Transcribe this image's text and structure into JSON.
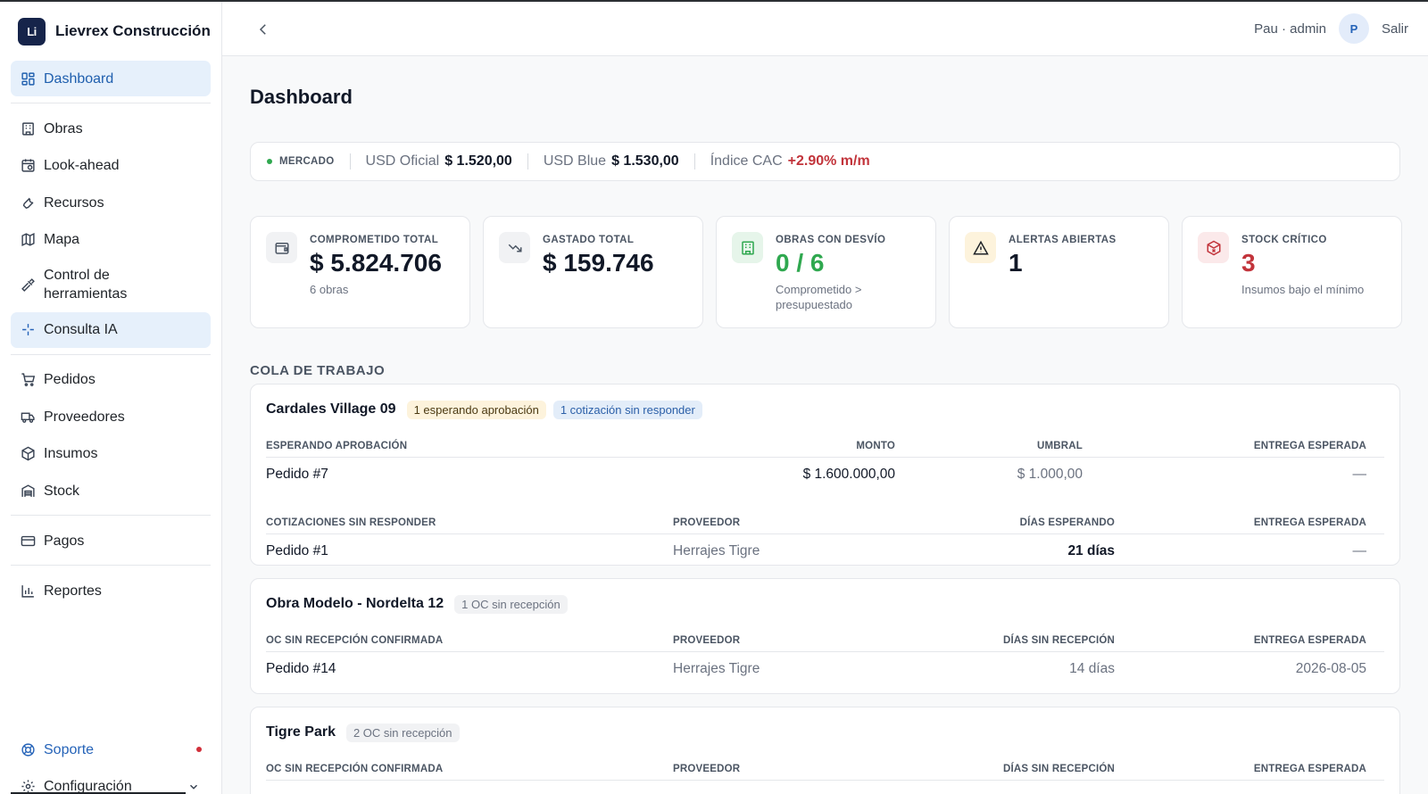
{
  "app": {
    "brand_name": "Lievrex Construcción",
    "logo_text": "Li"
  },
  "sidebar": {
    "items": [
      {
        "label": "Dashboard",
        "icon": "dashboard-icon"
      },
      {
        "label": "Obras",
        "icon": "building-icon"
      },
      {
        "label": "Look-ahead",
        "icon": "calendar-clock-icon"
      },
      {
        "label": "Recursos",
        "icon": "wrench-icon"
      },
      {
        "label": "Mapa",
        "icon": "map-icon"
      },
      {
        "label": "Control de herramientas",
        "icon": "hammer-icon"
      },
      {
        "label": "Consulta IA",
        "icon": "sparkle-icon"
      },
      {
        "label": "Pedidos",
        "icon": "cart-icon"
      },
      {
        "label": "Proveedores",
        "icon": "truck-icon"
      },
      {
        "label": "Insumos",
        "icon": "box-icon"
      },
      {
        "label": "Stock",
        "icon": "warehouse-icon"
      },
      {
        "label": "Pagos",
        "icon": "credit-card-icon"
      },
      {
        "label": "Reportes",
        "icon": "bar-chart-icon"
      }
    ],
    "support_label": "Soporte",
    "settings_label": "Configuración"
  },
  "topbar": {
    "user_label": "Pau · admin",
    "avatar_initial": "P",
    "logout_label": "Salir"
  },
  "page": {
    "title": "Dashboard"
  },
  "market": {
    "tag": "MERCADO",
    "usd_oficial_label": "USD Oficial",
    "usd_oficial_value": "$ 1.520,00",
    "usd_blue_label": "USD Blue",
    "usd_blue_value": "$ 1.530,00",
    "cac_label": "Índice CAC",
    "cac_value": "+2.90% m/m"
  },
  "kpis": [
    {
      "label": "COMPROMETIDO TOTAL",
      "value": "$ 5.824.706",
      "sub": "6 obras",
      "icon": "wallet-icon"
    },
    {
      "label": "GASTADO TOTAL",
      "value": "$ 159.746",
      "sub": "",
      "icon": "trending-down-icon"
    },
    {
      "label": "OBRAS CON DESVÍO",
      "value": "0 / 6",
      "sub": "Comprometido > presupuestado",
      "icon": "building-icon"
    },
    {
      "label": "ALERTAS ABIERTAS",
      "value": "1",
      "sub": "",
      "icon": "warning-icon"
    },
    {
      "label": "STOCK CRÍTICO",
      "value": "3",
      "sub": "Insumos bajo el mínimo",
      "icon": "package-x-icon"
    }
  ],
  "colors": {
    "accent": "#2563b8",
    "green": "#2fa84f",
    "red": "#c2343b"
  },
  "queue": {
    "title": "COLA DE TRABAJO",
    "cards": [
      {
        "title": "Cardales Village 09",
        "badges": [
          "1 esperando aprobación",
          "1 cotización sin responder"
        ],
        "approval": {
          "headers": [
            "ESPERANDO APROBACIÓN",
            "MONTO",
            "UMBRAL",
            "ENTREGA ESPERADA"
          ],
          "rows": [
            [
              "Pedido #7",
              "$ 1.600.000,00",
              "$ 1.000,00",
              "—"
            ]
          ]
        },
        "quotes": {
          "headers": [
            "COTIZACIONES SIN RESPONDER",
            "PROVEEDOR",
            "DÍAS ESPERANDO",
            "ENTREGA ESPERADA"
          ],
          "rows": [
            [
              "Pedido #1",
              "Herrajes Tigre",
              "21 días",
              "—"
            ]
          ]
        }
      },
      {
        "title": "Obra Modelo - Nordelta 12",
        "badges": [
          "1 OC sin recepción"
        ],
        "table": {
          "headers": [
            "OC SIN RECEPCIÓN CONFIRMADA",
            "PROVEEDOR",
            "DÍAS SIN RECEPCIÓN",
            "ENTREGA ESPERADA"
          ],
          "rows": [
            [
              "Pedido #14",
              "Herrajes Tigre",
              "14 días",
              "2026-08-05"
            ]
          ]
        }
      },
      {
        "title": "Tigre Park",
        "badges": [
          "2 OC sin recepción"
        ],
        "table": {
          "headers": [
            "OC SIN RECEPCIÓN CONFIRMADA",
            "PROVEEDOR",
            "DÍAS SIN RECEPCIÓN",
            "ENTREGA ESPERADA"
          ]
        }
      }
    ]
  }
}
